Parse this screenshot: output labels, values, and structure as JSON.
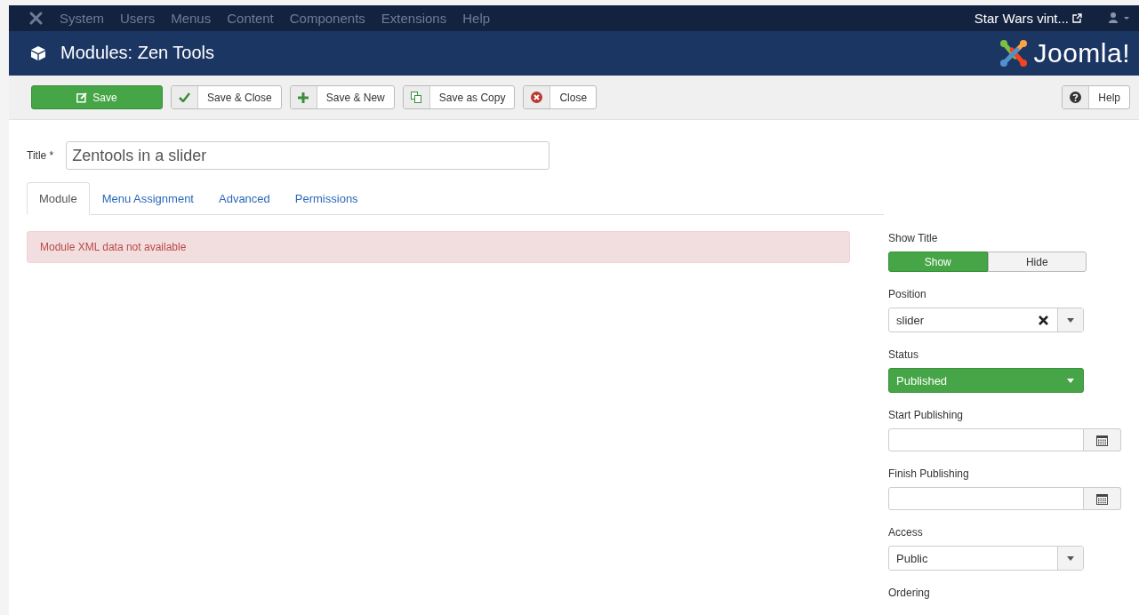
{
  "navbar": {
    "menu": [
      "System",
      "Users",
      "Menus",
      "Content",
      "Components",
      "Extensions",
      "Help"
    ],
    "site_link": "Star Wars vint..."
  },
  "header": {
    "title": "Modules: Zen Tools",
    "logo_text": "Joomla!"
  },
  "toolbar": {
    "buttons": [
      {
        "kind": "primary",
        "label": "Save"
      },
      {
        "kind": "check",
        "label": "Save & Close"
      },
      {
        "kind": "plus",
        "label": "Save & New"
      },
      {
        "kind": "copy",
        "label": "Save as Copy"
      },
      {
        "kind": "cancel",
        "label": "Close"
      }
    ],
    "help": "Help"
  },
  "title_field": {
    "label": "Title *",
    "value": "Zentools in a slider"
  },
  "tabs": [
    {
      "label": "Module",
      "selected": true
    },
    {
      "label": "Menu Assignment",
      "selected": false
    },
    {
      "label": "Advanced",
      "selected": false
    },
    {
      "label": "Permissions",
      "selected": false
    }
  ],
  "alert": "Module XML data not available",
  "sidebar": [
    {
      "kind": "toggle",
      "label": "Show Title",
      "options": [
        {
          "label": "Show",
          "selected": true
        },
        {
          "label": "Hide",
          "selected": false
        }
      ]
    },
    {
      "kind": "select-clear",
      "label": "Position",
      "value": "slider"
    },
    {
      "kind": "status",
      "label": "Status",
      "value": "Published"
    },
    {
      "kind": "date",
      "label": "Start Publishing"
    },
    {
      "kind": "date",
      "label": "Finish Publishing"
    },
    {
      "kind": "select",
      "label": "Access",
      "value": "Public"
    },
    {
      "kind": "label-only",
      "label": "Ordering"
    }
  ]
}
